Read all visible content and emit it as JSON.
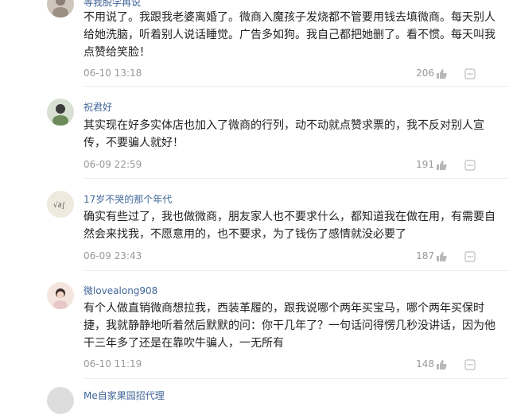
{
  "comments": [
    {
      "username": "等我脱学再说",
      "content": "不用说了。我跟我老婆离婚了。微商入魔孩子发烧都不管要用钱去填微商。每天别人给她洗脑，听着别人说话睡觉。广告多如狗。我自己都把她删了。看不惯。每天叫我点赞给笑脸！",
      "time": "06-10 13:18",
      "likes": "206"
    },
    {
      "username": "祝君好",
      "content": "其实现在好多实体店也加入了微商的行列，动不动就点赞求票的，我不反对别人宣传，不要骗人就好！",
      "time": "06-09 22:59",
      "likes": "191"
    },
    {
      "username": "17岁不哭的那个年代",
      "content": "确实有些过了，我也做微商，朋友家人也不要求什么，都知道我在做在用，有需要自然会来找我，不愿意用的，也不要求，为了钱伤了感情就没必要了",
      "time": "06-09 23:43",
      "likes": "187"
    },
    {
      "username": "微lovealong908",
      "content": "有个人做直销微商想拉我，西装革履的，跟我说哪个两年买宝马，哪个两年买保时捷，我就静静地听着然后默默的问：你干几年了？一句话问得愣几秒没讲话，因为他干三年多了还是在靠吹牛骗人，一无所有",
      "time": "06-10 11:19",
      "likes": "148"
    },
    {
      "username": "Me自家果园招代理"
    }
  ],
  "icons": {
    "like": "thumbs-up-icon",
    "more": "more-icon"
  },
  "colors": {
    "username": "#406599",
    "text": "#222222",
    "meta": "#999999"
  }
}
